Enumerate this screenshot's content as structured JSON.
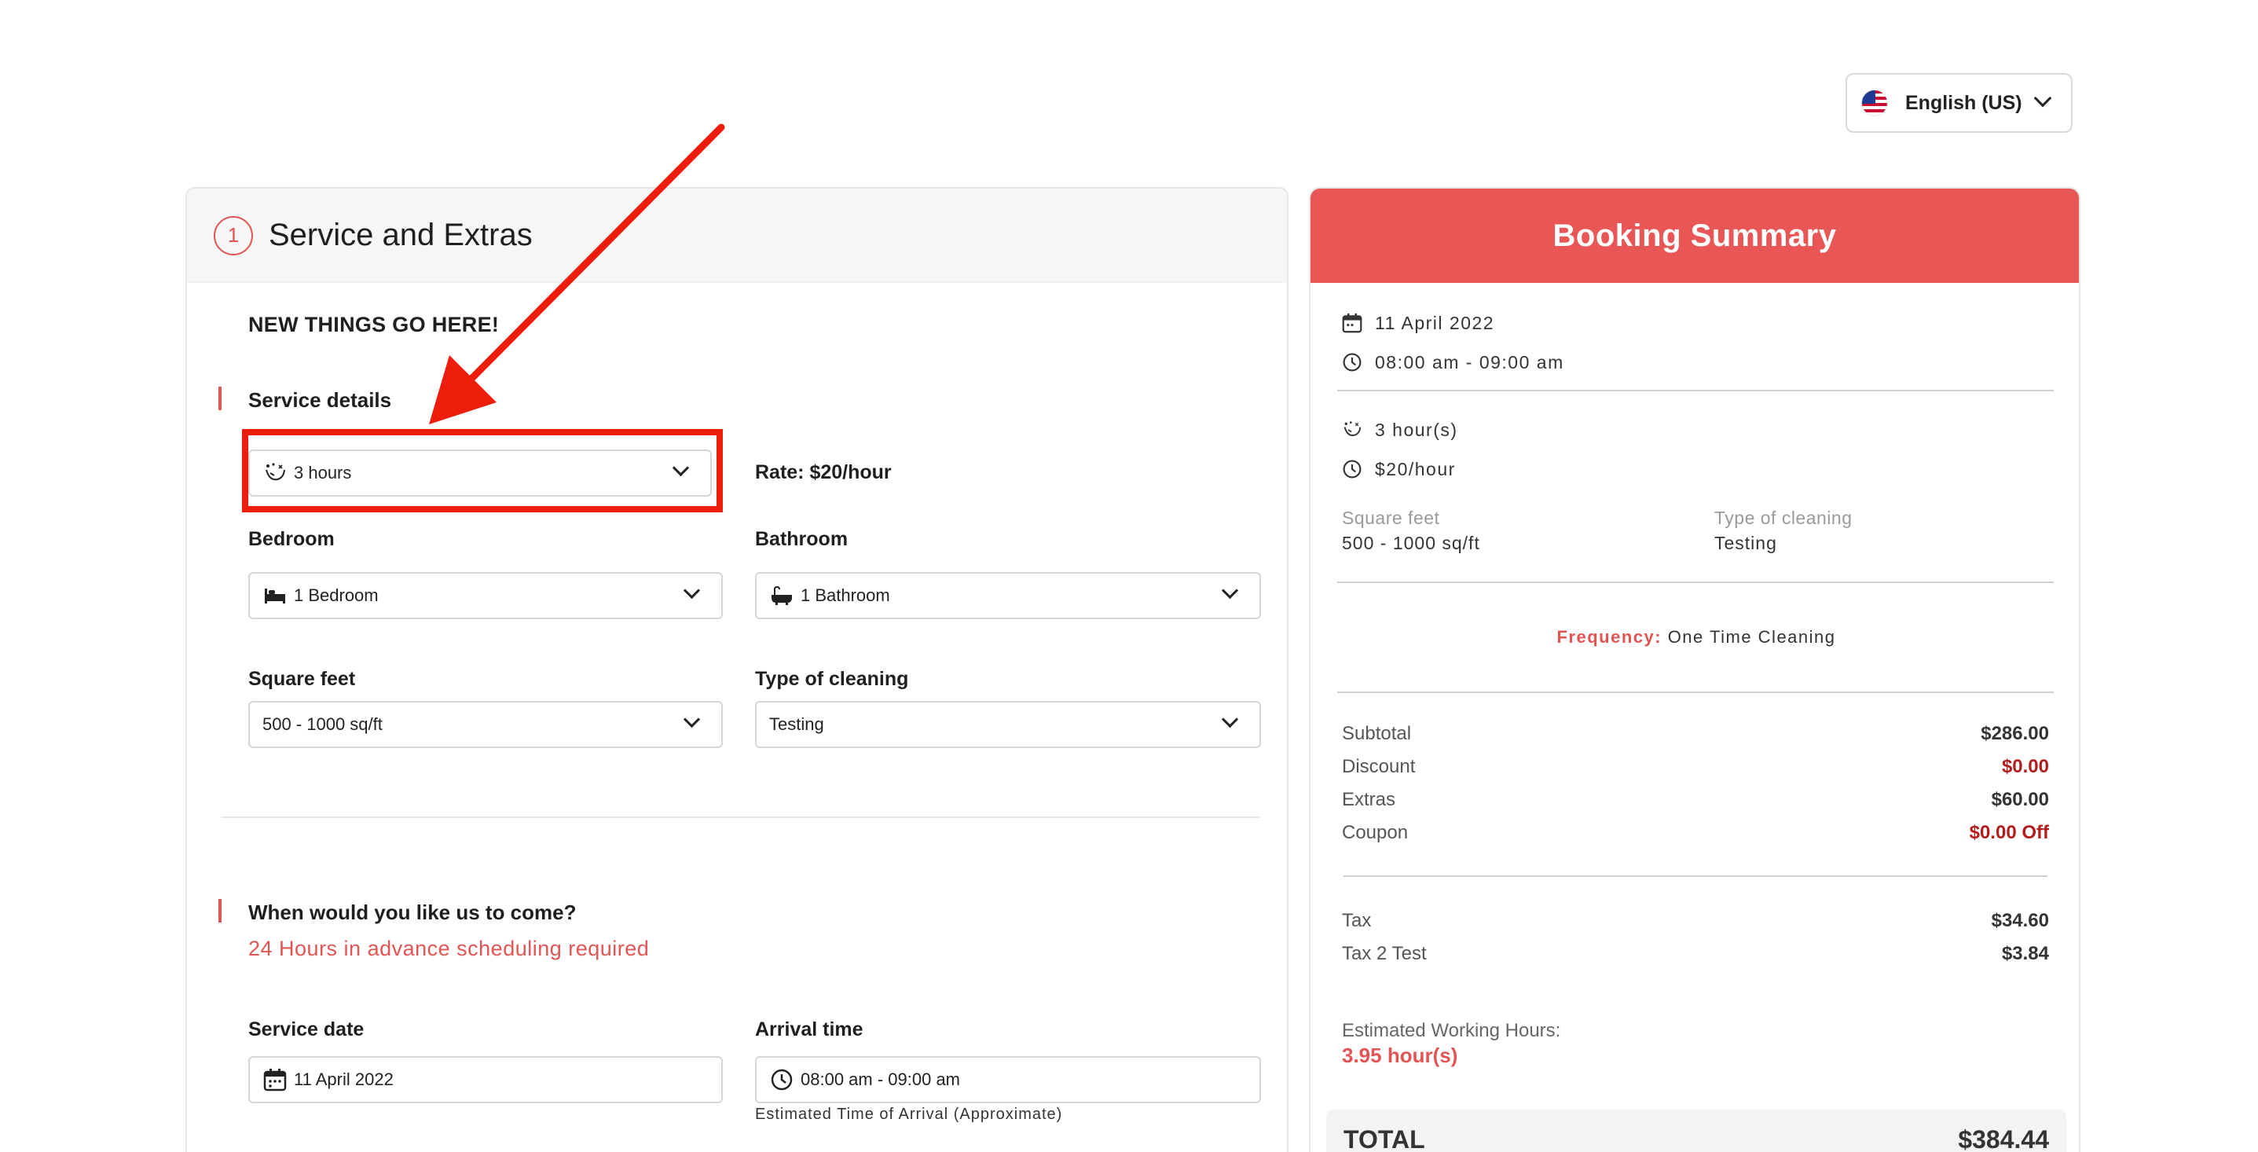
{
  "language": {
    "label": "English (US)"
  },
  "service": {
    "step_number": "1",
    "title": "Service and Extras",
    "notice": "NEW THINGS GO HERE!",
    "details_title": "Service details",
    "hours_value": "3 hours",
    "rate": "Rate: $20/hour",
    "bedroom_label": "Bedroom",
    "bedroom_value": "1 Bedroom",
    "bathroom_label": "Bathroom",
    "bathroom_value": "1 Bathroom",
    "sqft_label": "Square feet",
    "sqft_value": "500 - 1000 sq/ft",
    "cleaning_label": "Type of cleaning",
    "cleaning_value": "Testing"
  },
  "schedule": {
    "title": "When would you like us to come?",
    "advance_note": "24 Hours in advance scheduling required",
    "date_label": "Service date",
    "date_value": "11 April 2022",
    "time_label": "Arrival time",
    "time_value": "08:00 am - 09:00 am",
    "eta_note": "Estimated Time of Arrival (Approximate)"
  },
  "summary": {
    "title": "Booking Summary",
    "date": "11 April 2022",
    "time": "08:00 am - 09:00 am",
    "hours": "3 hour(s)",
    "rate": "$20/hour",
    "sqft_label": "Square feet",
    "sqft_value": "500 - 1000 sq/ft",
    "cleaning_label": "Type of cleaning",
    "cleaning_value": "Testing",
    "frequency_label": "Frequency:",
    "frequency_value": "One Time Cleaning",
    "subtotal_label": "Subtotal",
    "subtotal": "$286.00",
    "discount_label": "Discount",
    "discount": "$0.00",
    "extras_label": "Extras",
    "extras": "$60.00",
    "coupon_label": "Coupon",
    "coupon": "$0.00 Off",
    "tax_label": "Tax",
    "tax": "$34.60",
    "tax2_label": "Tax 2 Test",
    "tax2": "$3.84",
    "ewh_label": "Estimated Working Hours:",
    "ewh_value": "3.95 hour(s)",
    "total_label": "TOTAL",
    "total": "$384.44"
  },
  "colors": {
    "accent": "#e85656",
    "annotation": "#ee1c0a",
    "negative": "#b31d1d"
  }
}
